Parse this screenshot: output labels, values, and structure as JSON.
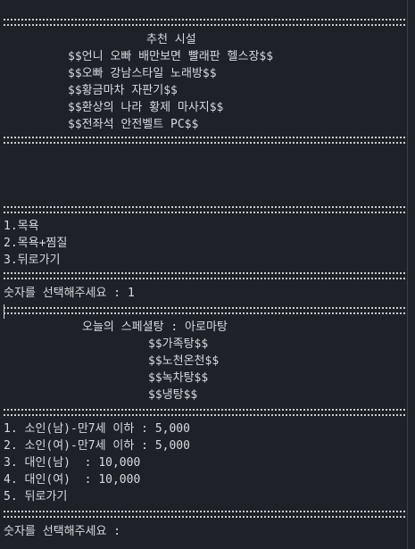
{
  "console": {
    "facilities_title": "추천 시설",
    "facilities": [
      "$$언니 오빠 배만보면 빨래판 헬스장$$",
      "$$오빠 강남스타일 노래방$$",
      "$$황금마차 자판기$$",
      "$$환상의 나라 황제 마사지$$",
      "$$전좌석 안전벨트 PC$$"
    ],
    "menu": [
      "1.목욕",
      "2.목욕+찜질",
      "3.뒤로가기"
    ],
    "prompt_1": "숫자를 선택해주세요 :",
    "input_1": "1",
    "special_label": "오늘의 스페셜탕 :",
    "special_value": "아로마탕",
    "baths": [
      "$$가족탕$$",
      "$$노천온천$$",
      "$$녹차탕$$",
      "$$냉탕$$"
    ],
    "prices": [
      "1. 소인(남)-만7세 이하 : 5,000",
      "2. 소인(여)-만7세 이하 : 5,000",
      "3. 대인(남)  : 10,000",
      "4. 대인(여)  : 10,000",
      "5. 뒤로가기"
    ],
    "prompt_2": "숫자를 선택해주세요 :"
  }
}
